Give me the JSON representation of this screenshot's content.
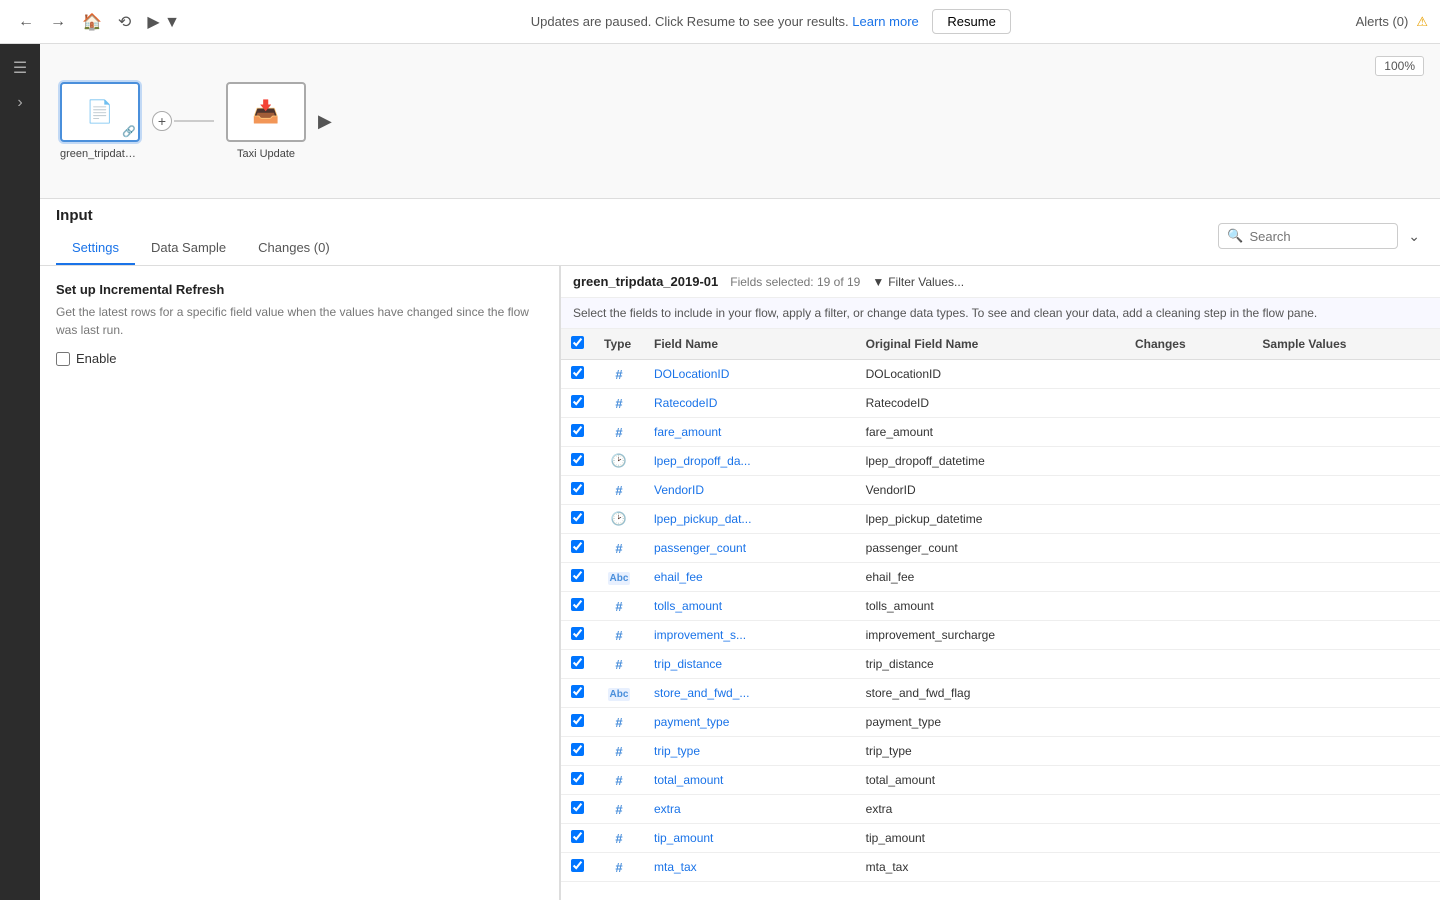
{
  "topbar": {
    "alert_label": "Alerts (0)",
    "update_msg": "Updates are paused. Click Resume to see your results.",
    "learn_more": "Learn more",
    "resume_btn": "Resume",
    "zoom": "100%"
  },
  "flow": {
    "node1_label": "green_tripdata...",
    "node2_label": "Taxi Update",
    "run_title": "Run"
  },
  "panel": {
    "title": "Input",
    "tabs": [
      {
        "label": "Settings",
        "active": true
      },
      {
        "label": "Data Sample",
        "active": false
      },
      {
        "label": "Changes (0)",
        "active": false
      }
    ],
    "search_placeholder": "Search"
  },
  "settings": {
    "heading": "Set up Incremental Refresh",
    "desc": "Get the latest rows for a specific field value when the values have changed since the flow was last run.",
    "enable_label": "Enable"
  },
  "data": {
    "dataset": "green_tripdata_2019-01",
    "fields_selected": "Fields selected: 19 of 19",
    "filter_btn": "Filter Values...",
    "description": "Select the fields to include in your flow, apply a filter, or change data types. To see and clean your data, add a cleaning step in the flow pane.",
    "columns": [
      "",
      "Type",
      "Field Name",
      "Original Field Name",
      "Changes",
      "Sample Values"
    ],
    "rows": [
      {
        "checked": true,
        "type": "number",
        "field": "DOLocationID",
        "original": "DOLocationID",
        "changes": "",
        "sample": ""
      },
      {
        "checked": true,
        "type": "number",
        "field": "RatecodeID",
        "original": "RatecodeID",
        "changes": "",
        "sample": ""
      },
      {
        "checked": true,
        "type": "number",
        "field": "fare_amount",
        "original": "fare_amount",
        "changes": "",
        "sample": ""
      },
      {
        "checked": true,
        "type": "datetime",
        "field": "lpep_dropoff_da...",
        "original": "lpep_dropoff_datetime",
        "changes": "",
        "sample": ""
      },
      {
        "checked": true,
        "type": "number",
        "field": "VendorID",
        "original": "VendorID",
        "changes": "",
        "sample": ""
      },
      {
        "checked": true,
        "type": "datetime",
        "field": "lpep_pickup_dat...",
        "original": "lpep_pickup_datetime",
        "changes": "",
        "sample": ""
      },
      {
        "checked": true,
        "type": "number",
        "field": "passenger_count",
        "original": "passenger_count",
        "changes": "",
        "sample": ""
      },
      {
        "checked": true,
        "type": "abc",
        "field": "ehail_fee",
        "original": "ehail_fee",
        "changes": "",
        "sample": ""
      },
      {
        "checked": true,
        "type": "number",
        "field": "tolls_amount",
        "original": "tolls_amount",
        "changes": "",
        "sample": ""
      },
      {
        "checked": true,
        "type": "number",
        "field": "improvement_s...",
        "original": "improvement_surcharge",
        "changes": "",
        "sample": ""
      },
      {
        "checked": true,
        "type": "number",
        "field": "trip_distance",
        "original": "trip_distance",
        "changes": "",
        "sample": ""
      },
      {
        "checked": true,
        "type": "abc",
        "field": "store_and_fwd_...",
        "original": "store_and_fwd_flag",
        "changes": "",
        "sample": ""
      },
      {
        "checked": true,
        "type": "number",
        "field": "payment_type",
        "original": "payment_type",
        "changes": "",
        "sample": ""
      },
      {
        "checked": true,
        "type": "number",
        "field": "trip_type",
        "original": "trip_type",
        "changes": "",
        "sample": ""
      },
      {
        "checked": true,
        "type": "number",
        "field": "total_amount",
        "original": "total_amount",
        "changes": "",
        "sample": ""
      },
      {
        "checked": true,
        "type": "number",
        "field": "extra",
        "original": "extra",
        "changes": "",
        "sample": ""
      },
      {
        "checked": true,
        "type": "number",
        "field": "tip_amount",
        "original": "tip_amount",
        "changes": "",
        "sample": ""
      },
      {
        "checked": true,
        "type": "number",
        "field": "mta_tax",
        "original": "mta_tax",
        "changes": "",
        "sample": ""
      }
    ]
  }
}
